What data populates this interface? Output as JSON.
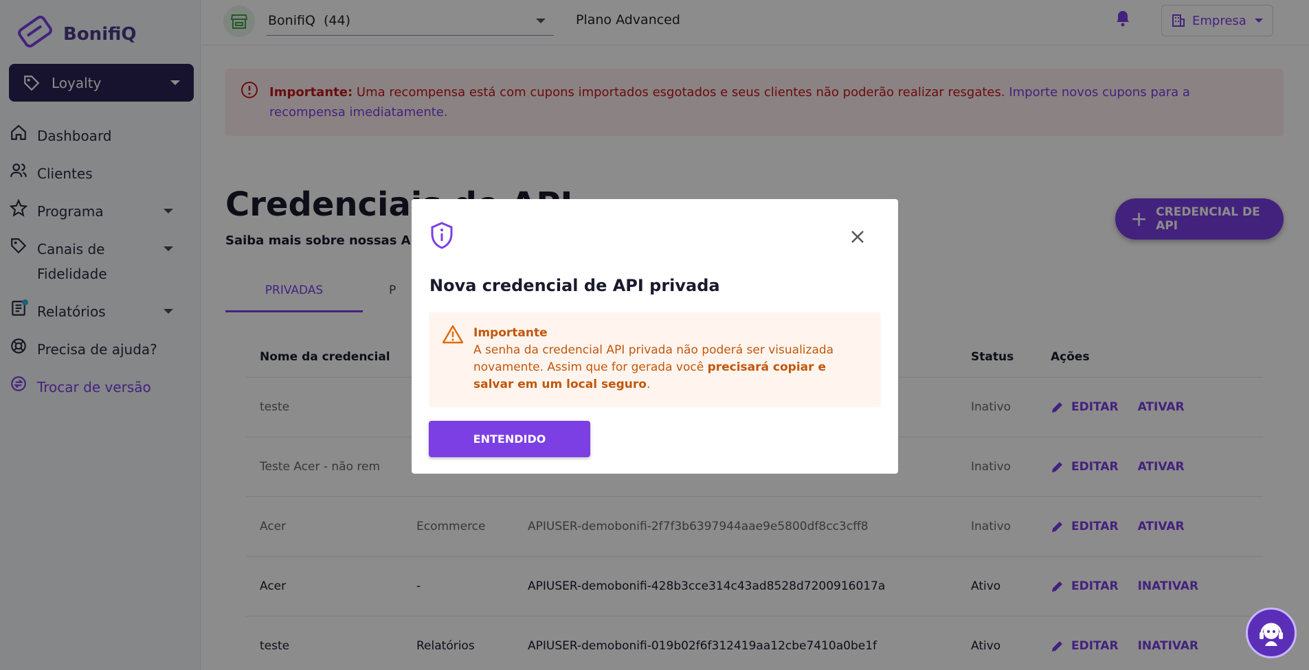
{
  "brand": {
    "name": "BonifiQ",
    "accent": "#7b3fe4",
    "dark": "#2b2357"
  },
  "sidebar": {
    "product_selector": "Loyalty",
    "items": [
      {
        "label": "Dashboard",
        "icon": "home-icon"
      },
      {
        "label": "Clientes",
        "icon": "users-icon"
      },
      {
        "label": "Programa",
        "icon": "star-icon"
      },
      {
        "label": "Canais de Fidelidade",
        "icon": "tag-icon"
      },
      {
        "label": "Relatórios",
        "icon": "report-icon"
      },
      {
        "label": "Precisa de ajuda?",
        "icon": "lifebuoy-icon"
      },
      {
        "label": "Trocar de versão",
        "icon": "swap-icon"
      }
    ]
  },
  "topbar": {
    "account": "BonifiQ  (44)",
    "plan": "Plano Advanced",
    "company_button": "Empresa"
  },
  "alert": {
    "strong": "Importante:",
    "message": " Uma recompensa está com cupons importados esgotados e seus clientes não poderão realizar resgates. ",
    "link": "Importe novos cupons para a recompensa imediatamente",
    "suffix": "."
  },
  "main": {
    "title": "Credenciais de API",
    "subtitle": "Saiba mais sobre nossas APIs",
    "add_button": "CREDENCIAL DE API",
    "tabs": [
      "PRIVADAS",
      "P"
    ],
    "table": {
      "headers": [
        "Nome da credencial",
        "",
        "",
        "Status",
        "Ações"
      ],
      "rows": [
        {
          "name": "teste",
          "type": "",
          "user": "",
          "status": "Inativo",
          "actions": [
            "EDITAR",
            "ATIVAR"
          ]
        },
        {
          "name": "Teste Acer - não rem",
          "type": "",
          "user": "",
          "status": "Inativo",
          "actions": [
            "EDITAR",
            "ATIVAR"
          ]
        },
        {
          "name": "Acer",
          "type": "Ecommerce",
          "user": "APIUSER-demobonifi-2f7f3b6397944aae9e5800df8cc3cff8",
          "status": "Inativo",
          "actions": [
            "EDITAR",
            "ATIVAR"
          ]
        },
        {
          "name": "Acer",
          "type": "-",
          "user": "APIUSER-demobonifi-428b3cce314c43ad8528d7200916017a",
          "status": "Ativo",
          "actions": [
            "EDITAR",
            "INATIVAR"
          ]
        },
        {
          "name": "teste",
          "type": "Relatórios",
          "user": "APIUSER-demobonifi-019b02f6f312419aa12cbe7410a0be1f",
          "status": "Ativo",
          "actions": [
            "EDITAR",
            "INATIVAR"
          ]
        }
      ]
    }
  },
  "modal": {
    "title": "Nova credencial de API privada",
    "warning_head": "Importante",
    "warning_text_1": "A senha da credencial API privada não poderá ser visualizada novamente. Assim que for gerada você ",
    "warning_bold": "precisará copiar e salvar em um local seguro",
    "warning_text_2": ".",
    "confirm_button": "ENTENDIDO"
  }
}
